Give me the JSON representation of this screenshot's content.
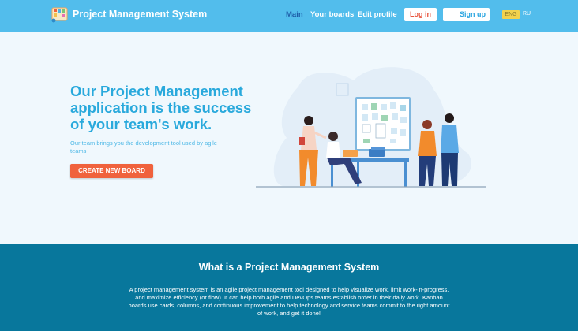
{
  "header": {
    "brand": "Project Management System",
    "nav": {
      "main": "Main",
      "boards": "Your boards",
      "edit_profile": "Edit profile"
    },
    "login": "Log in",
    "signup": "Sign up",
    "languages": {
      "eng": "ENG",
      "ru": "RU"
    },
    "active_nav": "Main",
    "active_language": "ENG"
  },
  "hero": {
    "title": "Our Project Management application is the success of your team's work.",
    "subtitle": "Our team brings you the development tool used by agile teams",
    "cta": "CREATE NEW BOARD"
  },
  "about": {
    "title": "What is a Project Management System",
    "text": "A project management system is an agile project management tool designed to help visualize work, limit work-in-progress, and maximize efficiency (or flow). It can help both agile and DevOps teams establish order in their daily work. Kanban boards use cards, columns, and continuous improvement to help technology and service teams commit to the right amount of work, and get it done!"
  },
  "colors": {
    "header_bg": "#52bdec",
    "accent": "#29a9dc",
    "cta": "#f0623d",
    "footer_bg": "#08779c",
    "active_nav": "#1e5da8"
  },
  "icons": {
    "logo": "kanban-board-logo-icon",
    "illustration": "team-meeting-illustration"
  }
}
